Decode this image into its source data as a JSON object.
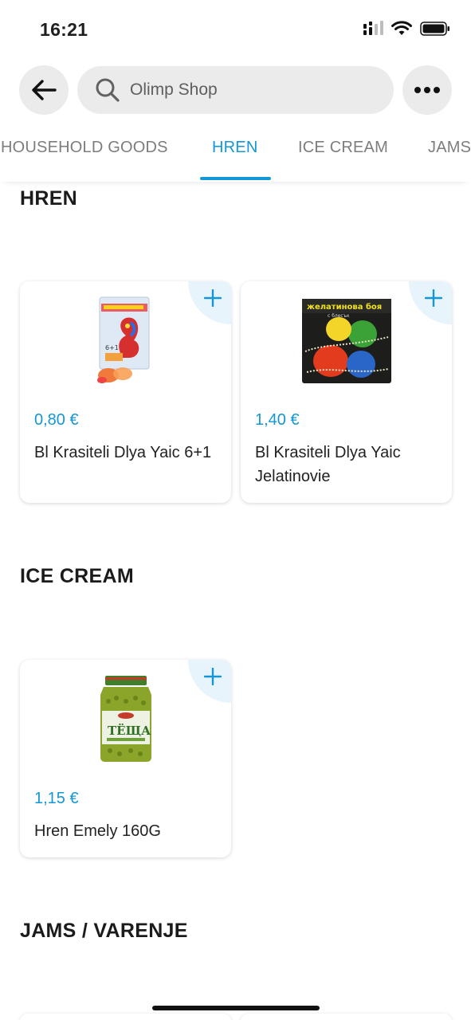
{
  "status_bar": {
    "time": "16:21",
    "icons": [
      "cellular-signal-icon",
      "wifi-icon",
      "battery-icon"
    ]
  },
  "header": {
    "back_icon": "arrow-left-icon",
    "search_icon": "search-icon",
    "search_text": "Olimp Shop",
    "more_icon": "more-dots-icon"
  },
  "tabs": [
    {
      "label": "HOUSEHOLD GOODS",
      "active": false
    },
    {
      "label": "HREN",
      "active": true
    },
    {
      "label": "ICE CREAM",
      "active": false
    },
    {
      "label": "JAMS",
      "active": false
    }
  ],
  "sections": [
    {
      "title": "HREN",
      "products": [
        {
          "price": "0,80 €",
          "name": "Bl Krasiteli Dlya Yaic 6+1",
          "image": "egg-dye-packet"
        },
        {
          "price": "1,40 €",
          "name": "Bl Krasiteli Dlya Yaic Jelatinovie",
          "image": "gelatin-egg-dye-box"
        }
      ]
    },
    {
      "title": "ICE CREAM",
      "products": [
        {
          "price": "1,15 €",
          "name": "Hren Emely 160G",
          "image": "green-peas-jar"
        }
      ]
    },
    {
      "title": "JAMS / VARENJE",
      "products": []
    }
  ],
  "colors": {
    "accent": "#1497d4",
    "pill_bg": "#ebebeb",
    "add_bg": "#e8f4fb"
  }
}
